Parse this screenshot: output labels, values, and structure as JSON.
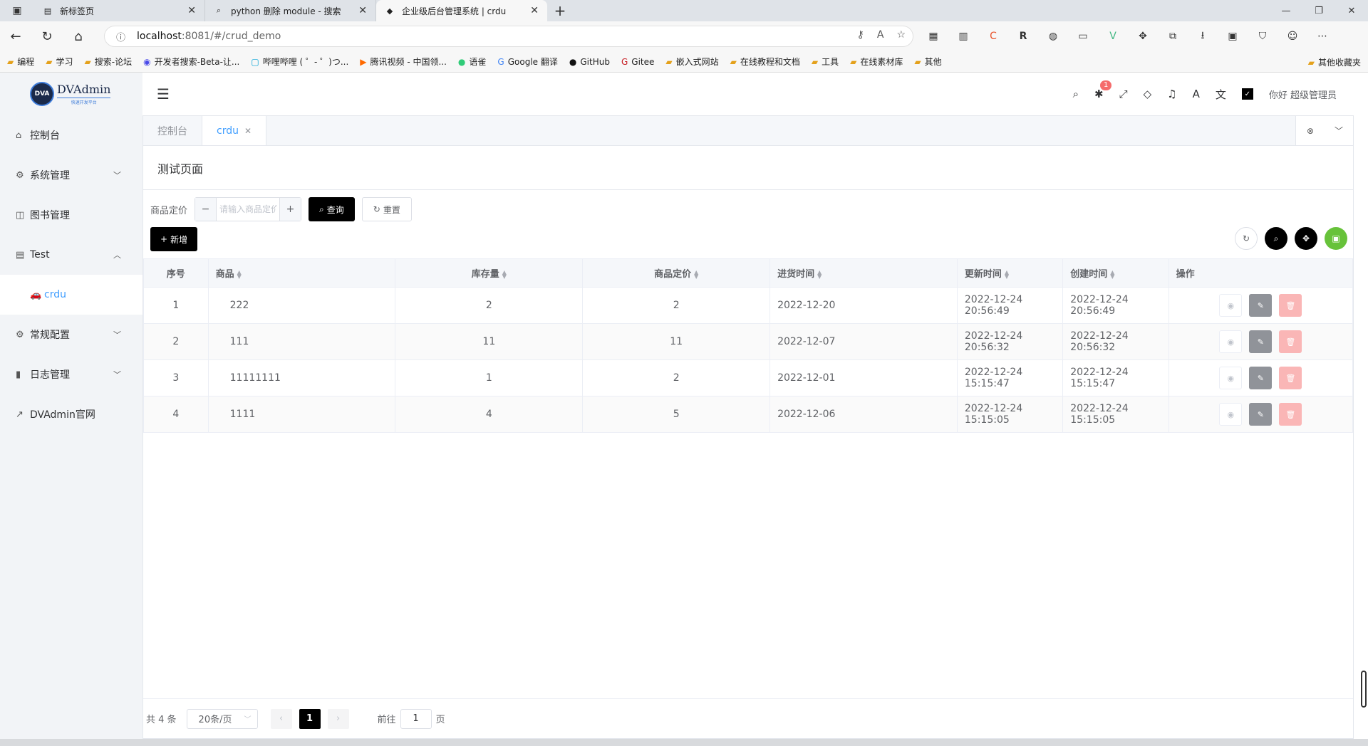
{
  "browser": {
    "tabs": [
      {
        "title": "新标签页",
        "icon": "newtab-icon"
      },
      {
        "title": "python 删除 module - 搜索",
        "icon": "search-icon"
      },
      {
        "title": "企业级后台管理系统 | crdu",
        "icon": "vue-icon"
      }
    ],
    "url_host": "localhost",
    "url_path": ":8081/#/crud_demo",
    "bookmarks": [
      "编程",
      "学习",
      "搜索-论坛",
      "开发者搜索-Beta-让...",
      "哔哩哔哩 ( ゜- ゜)つ...",
      "腾讯视频 - 中国领...",
      "语雀",
      "Google 翻译",
      "GitHub",
      "Gitee",
      "嵌入式网站",
      "在线教程和文档",
      "工具",
      "在线素材库",
      "其他"
    ],
    "bookmark_other": "其他收藏夹"
  },
  "app": {
    "logo_text": "DVAdmin",
    "logo_badge": "DVA",
    "logo_sub": "快速开发平台",
    "menu": {
      "dashboard": "控制台",
      "system": "系统管理",
      "books": "图书管理",
      "test": "Test",
      "crdu": "crdu",
      "config": "常规配置",
      "logs": "日志管理",
      "site": "DVAdmin官网"
    },
    "topbar": {
      "badge_count": "1",
      "greeting": "你好 超级管理员"
    },
    "tags": {
      "dashboard": "控制台",
      "current": "crdu"
    },
    "page_title": "测试页面",
    "search": {
      "label": "商品定价",
      "placeholder": "请输入商品定价",
      "query_btn": "查询",
      "reset_btn": "重置"
    },
    "add_btn": "新增",
    "table": {
      "headers": [
        "序号",
        "商品",
        "库存量",
        "商品定价",
        "进货时间",
        "更新时间",
        "创建时间",
        "操作"
      ],
      "rows": [
        {
          "idx": "1",
          "goods": "222",
          "stock": "2",
          "price": "2",
          "purchase": "2022-12-20",
          "updated": "2022-12-24 20:56:49",
          "created": "2022-12-24 20:56:49"
        },
        {
          "idx": "2",
          "goods": "111",
          "stock": "11",
          "price": "11",
          "purchase": "2022-12-07",
          "updated": "2022-12-24 20:56:32",
          "created": "2022-12-24 20:56:32"
        },
        {
          "idx": "3",
          "goods": "11111111",
          "stock": "1",
          "price": "2",
          "purchase": "2022-12-01",
          "updated": "2022-12-24 15:15:47",
          "created": "2022-12-24 15:15:47"
        },
        {
          "idx": "4",
          "goods": "1111",
          "stock": "4",
          "price": "5",
          "purchase": "2022-12-06",
          "updated": "2022-12-24 15:15:05",
          "created": "2022-12-24 15:15:05"
        }
      ]
    },
    "pager": {
      "total": "共 4 条",
      "page_size": "20条/页",
      "current": "1",
      "goto_label": "前往",
      "goto_value": "1",
      "page_suffix": "页"
    }
  }
}
